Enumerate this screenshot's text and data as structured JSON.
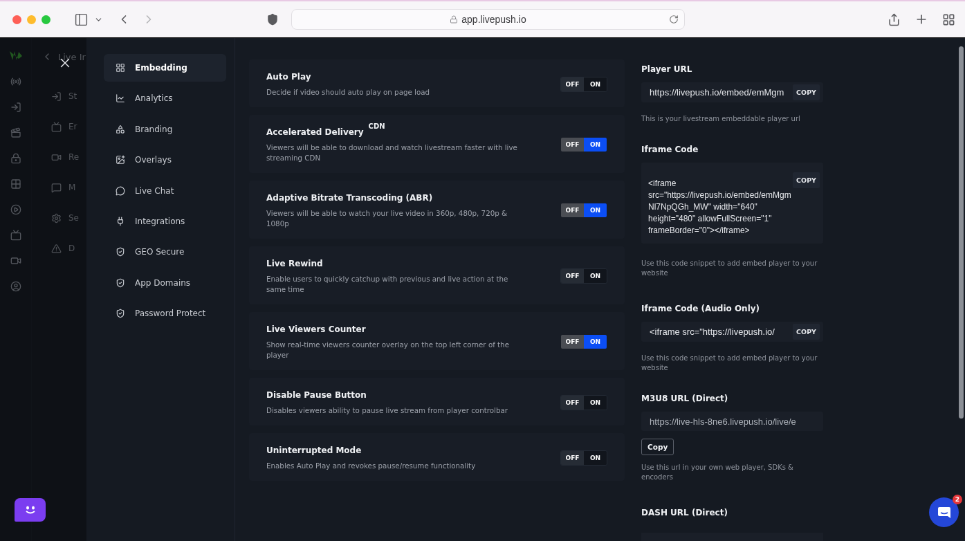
{
  "browser": {
    "url": "app.livepush.io"
  },
  "background_nav": {
    "title": "Live Ir",
    "items": [
      {
        "label": "St"
      },
      {
        "label": "Er"
      },
      {
        "label": "Re"
      },
      {
        "label": "M"
      },
      {
        "label": "Se"
      },
      {
        "label": "D"
      }
    ]
  },
  "menu": {
    "items": [
      {
        "label": "Embedding",
        "selected": true
      },
      {
        "label": "Analytics",
        "selected": false
      },
      {
        "label": "Branding",
        "selected": false
      },
      {
        "label": "Overlays",
        "selected": false
      },
      {
        "label": "Live Chat",
        "selected": false
      },
      {
        "label": "Integrations",
        "selected": false
      },
      {
        "label": "GEO Secure",
        "selected": false
      },
      {
        "label": "App Domains",
        "selected": false
      },
      {
        "label": "Password Protect",
        "selected": false
      }
    ]
  },
  "settings": [
    {
      "title": "Auto Play",
      "description": "Decide if video should auto play on page load",
      "on": false,
      "off_label": "OFF",
      "on_label": "ON"
    },
    {
      "title": "Accelerated Delivery",
      "badge": "CDN",
      "description": "Viewers will be able to download and watch livestream faster with live streaming CDN",
      "on": true,
      "off_label": "OFF",
      "on_label": "ON"
    },
    {
      "title": "Adaptive Bitrate Transcoding (ABR)",
      "description": "Viewers will be able to watch your live video in 360p, 480p, 720p & 1080p",
      "on": true,
      "off_label": "OFF",
      "on_label": "ON"
    },
    {
      "title": "Live Rewind",
      "description": "Enable users to quickly catchup with previous and live action at the same time",
      "on": false,
      "off_label": "OFF",
      "on_label": "ON"
    },
    {
      "title": "Live Viewers Counter",
      "description": "Show real-time viewers counter overlay on the top left corner of the player",
      "on": true,
      "off_label": "OFF",
      "on_label": "ON"
    },
    {
      "title": "Disable Pause Button",
      "description": "Disables viewers ability to pause live stream from player controlbar",
      "on": false,
      "off_label": "OFF",
      "on_label": "ON"
    },
    {
      "title": "Uninterrupted Mode",
      "description": "Enables Auto Play and revokes pause/resume functionality",
      "on": false,
      "off_label": "OFF",
      "on_label": "ON"
    }
  ],
  "embed_fields": [
    {
      "kind": "input",
      "label": "Player URL",
      "value": "https://livepush.io/embed/emMgm",
      "copy": "COPY",
      "help": "This is your livestream embeddable player url"
    },
    {
      "kind": "textarea",
      "label": "Iframe Code",
      "value": "<iframe src=\"https://livepush.io/embed/emMgmNl7NpQGh_MW\" width=\"640\" height=\"480\" allowFullScreen=\"1\" frameBorder=\"0\"></iframe>",
      "copy": "COPY",
      "help": "Use this code snippet to add embed player to your website"
    },
    {
      "kind": "input",
      "label": "Iframe Code (Audio Only)",
      "value": "<iframe src=\"https://livepush.io/",
      "copy": "COPY",
      "help": "Use this code snippet to add embed player to your website"
    },
    {
      "kind": "button_below",
      "label": "M3U8 URL (Direct)",
      "value": "https://live-hls-8ne6.livepush.io/live/e",
      "copy": "Copy",
      "help": "Use this url in your own web player, SDKs & encoders"
    },
    {
      "kind": "cut",
      "label": "DASH URL (Direct)"
    }
  ],
  "chat": {
    "badge": "2"
  }
}
